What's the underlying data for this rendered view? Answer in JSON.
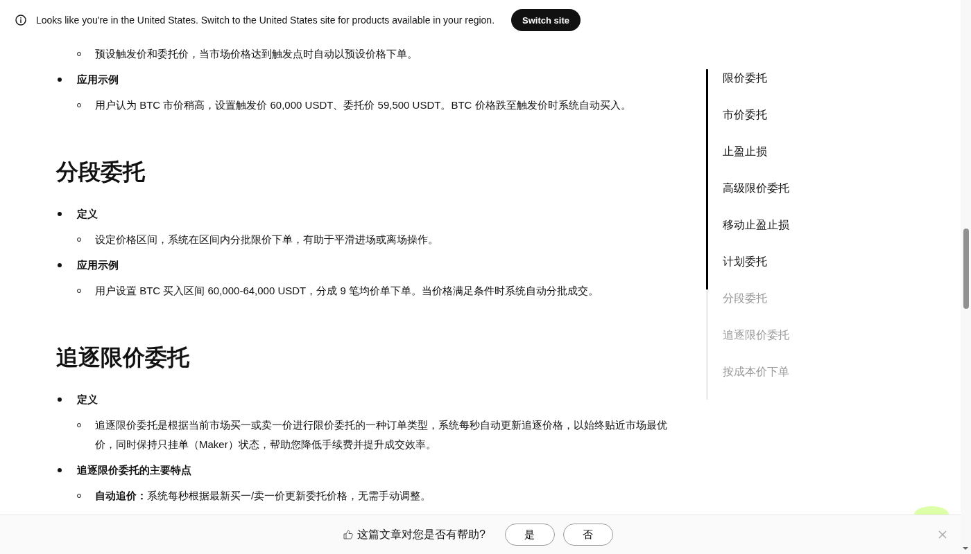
{
  "banner": {
    "text": "Looks like you're in the United States. Switch to the United States site for products available in your region.",
    "button": "Switch site"
  },
  "sections": [
    {
      "items": [
        {
          "details": [
            "预设触发价和委托价，当市场价格达到触发点时自动以预设价格下单。"
          ]
        },
        {
          "label": "应用示例",
          "details": [
            "用户认为 BTC 市价稍高，设置触发价 60,000 USDT、委托价 59,500 USDT。BTC 价格跌至触发价时系统自动买入。"
          ]
        }
      ]
    },
    {
      "heading": "分段委托",
      "items": [
        {
          "label": "定义",
          "details": [
            "设定价格区间，系统在区间内分批限价下单，有助于平滑进场或离场操作。"
          ]
        },
        {
          "label": "应用示例",
          "details": [
            "用户设置 BTC 买入区间 60,000-64,000 USDT，分成 9 笔均价单下单。当价格满足条件时系统自动分批成交。"
          ]
        }
      ]
    },
    {
      "heading": "追逐限价委托",
      "items": [
        {
          "label": "定义",
          "details": [
            "追逐限价委托是根据当前市场买一或卖一价进行限价委托的一种订单类型，系统每秒自动更新追逐价格，以始终贴近市场最优价，同时保持只挂单（Maker）状态，帮助您降低手续费并提升成交效率。"
          ]
        },
        {
          "label": "追逐限价委托的主要特点",
          "details": [
            "**自动追价：**系统每秒根据最新买一/卖一价更新委托价格，无需手动调整。"
          ]
        }
      ]
    }
  ],
  "toc": [
    {
      "label": "限价委托",
      "active": true
    },
    {
      "label": "市价委托",
      "active": true
    },
    {
      "label": "止盈止损",
      "active": true
    },
    {
      "label": "高级限价委托",
      "active": true
    },
    {
      "label": "移动止盈止损",
      "active": true
    },
    {
      "label": "计划委托",
      "active": true
    },
    {
      "label": "分段委托",
      "active": false
    },
    {
      "label": "追逐限价委托",
      "active": false
    },
    {
      "label": "按成本价下单",
      "active": false
    }
  ],
  "feedback": {
    "question": "这篇文章对您是否有帮助?",
    "buttons": [
      "是",
      "否"
    ]
  }
}
